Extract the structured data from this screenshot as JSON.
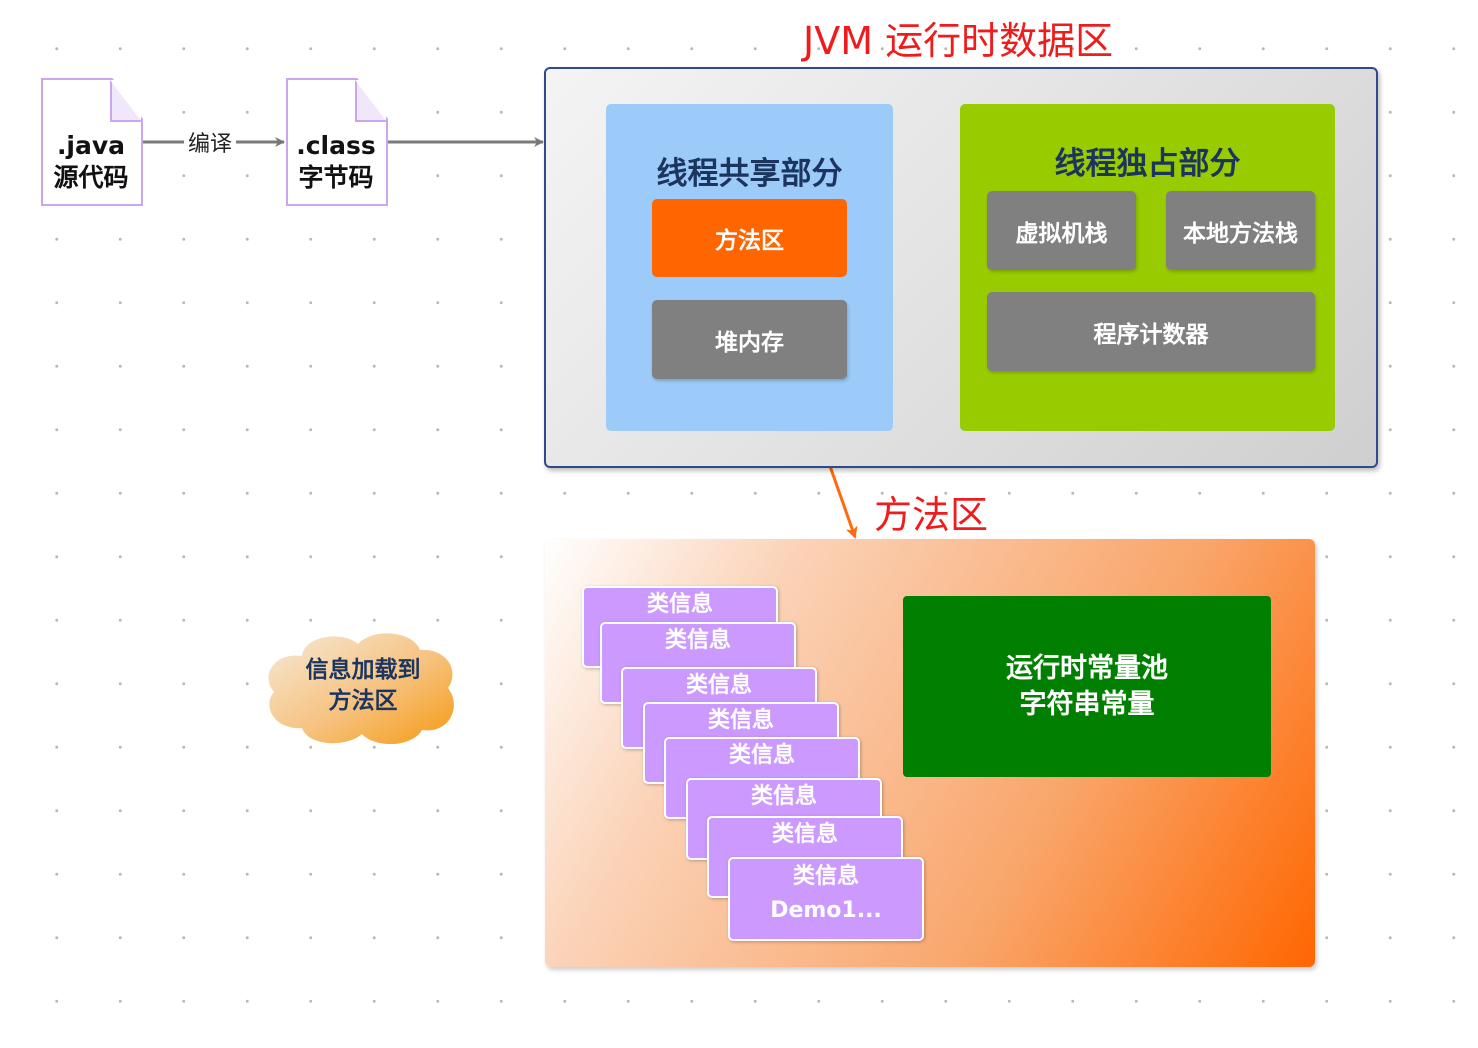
{
  "java_file": {
    "line1": ".java",
    "line2": "源代码"
  },
  "class_file": {
    "line1": ".class",
    "line2": "字节码"
  },
  "compile_label": "编译",
  "jvm_title": "JVM 运行时数据区",
  "shared": {
    "title": "线程共享部分",
    "method_area": "方法区",
    "heap": "堆内存"
  },
  "exclusive": {
    "title": "线程独占部分",
    "vm_stack": "虚拟机栈",
    "native_stack": "本地方法栈",
    "pc_counter": "程序计数器"
  },
  "method_area_title": "方法区",
  "class_cards": [
    {
      "label": "类信息"
    },
    {
      "label": "类信息"
    },
    {
      "label": "类信息"
    },
    {
      "label": "类信息"
    },
    {
      "label": "类信息"
    },
    {
      "label": "类信息"
    },
    {
      "label": "类信息"
    },
    {
      "label": "类信息",
      "sub": "Demo1..."
    }
  ],
  "pool": {
    "line1": "运行时常量池",
    "line2": "字符串常量"
  },
  "cloud": {
    "line1": "信息加载到",
    "line2": "方法区"
  },
  "colors": {
    "title_red": "#ee1c1c",
    "shared_blue": "#9ccbf9",
    "exclusive_green": "#99cc00",
    "method_orange": "#ff6600",
    "gray_box": "#808080",
    "class_purple": "#cc99ff",
    "pool_green": "#007f00"
  }
}
